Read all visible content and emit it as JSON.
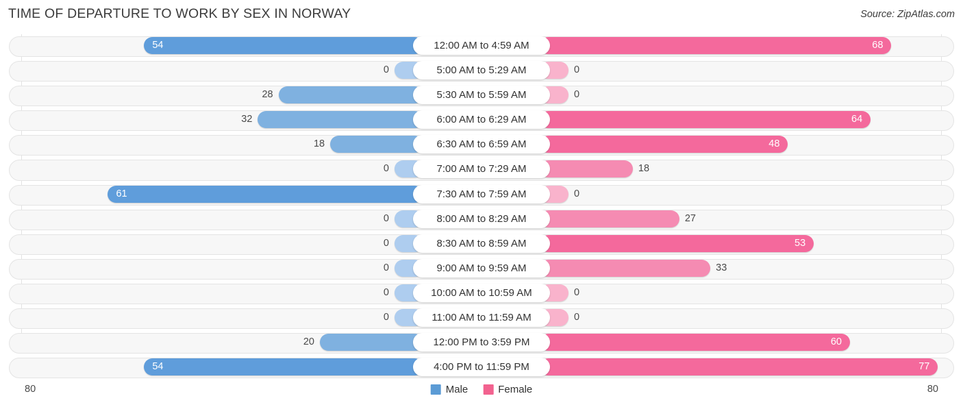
{
  "header": {
    "title": "TIME OF DEPARTURE TO WORK BY SEX IN NORWAY",
    "source": "Source: ZipAtlas.com"
  },
  "axis": {
    "left_end": "80",
    "right_end": "80"
  },
  "legend": {
    "items": [
      {
        "label": "Male",
        "color": "#5b9bd5"
      },
      {
        "label": "Female",
        "color": "#f2628f"
      }
    ]
  },
  "colors": {
    "male_strong": "#5f9ddb",
    "male_light": "#aecdef",
    "female_strong": "#f4699c",
    "female_light": "#f9b3cc",
    "track_fill": "#f7f7f7",
    "track_border": "#e4e4e4",
    "label_pill": "#ffffff"
  },
  "chart_data": {
    "type": "bar",
    "orientation": "horizontal-diverging",
    "title": "TIME OF DEPARTURE TO WORK BY SEX IN NORWAY",
    "xlabel": "",
    "ylabel": "",
    "xlim": [
      0,
      80
    ],
    "grid": true,
    "legend_position": "bottom-center",
    "categories": [
      "12:00 AM to 4:59 AM",
      "5:00 AM to 5:29 AM",
      "5:30 AM to 5:59 AM",
      "6:00 AM to 6:29 AM",
      "6:30 AM to 6:59 AM",
      "7:00 AM to 7:29 AM",
      "7:30 AM to 7:59 AM",
      "8:00 AM to 8:29 AM",
      "8:30 AM to 8:59 AM",
      "9:00 AM to 9:59 AM",
      "10:00 AM to 10:59 AM",
      "11:00 AM to 11:59 AM",
      "12:00 PM to 3:59 PM",
      "4:00 PM to 11:59 PM"
    ],
    "series": [
      {
        "name": "Male",
        "side": "left",
        "values": [
          54,
          0,
          28,
          32,
          18,
          0,
          61,
          0,
          0,
          0,
          0,
          0,
          20,
          54
        ]
      },
      {
        "name": "Female",
        "side": "right",
        "values": [
          68,
          0,
          0,
          64,
          48,
          18,
          0,
          27,
          53,
          33,
          0,
          0,
          60,
          77
        ]
      }
    ]
  },
  "rows": [
    {
      "label": "12:00 AM to 4:59 AM",
      "male": "54",
      "female": "68"
    },
    {
      "label": "5:00 AM to 5:29 AM",
      "male": "0",
      "female": "0"
    },
    {
      "label": "5:30 AM to 5:59 AM",
      "male": "28",
      "female": "0"
    },
    {
      "label": "6:00 AM to 6:29 AM",
      "male": "32",
      "female": "64"
    },
    {
      "label": "6:30 AM to 6:59 AM",
      "male": "18",
      "female": "48"
    },
    {
      "label": "7:00 AM to 7:29 AM",
      "male": "0",
      "female": "18"
    },
    {
      "label": "7:30 AM to 7:59 AM",
      "male": "61",
      "female": "0"
    },
    {
      "label": "8:00 AM to 8:29 AM",
      "male": "0",
      "female": "27"
    },
    {
      "label": "8:30 AM to 8:59 AM",
      "male": "0",
      "female": "53"
    },
    {
      "label": "9:00 AM to 9:59 AM",
      "male": "0",
      "female": "33"
    },
    {
      "label": "10:00 AM to 10:59 AM",
      "male": "0",
      "female": "0"
    },
    {
      "label": "11:00 AM to 11:59 AM",
      "male": "0",
      "female": "0"
    },
    {
      "label": "12:00 PM to 3:59 PM",
      "male": "20",
      "female": "60"
    },
    {
      "label": "4:00 PM to 11:59 PM",
      "male": "54",
      "female": "77"
    }
  ]
}
